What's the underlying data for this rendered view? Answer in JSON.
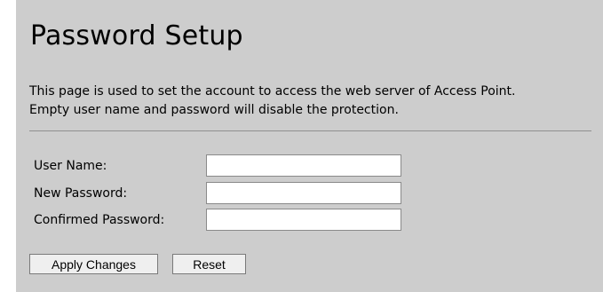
{
  "page": {
    "title": "Password Setup",
    "description_line1": "This page is used to set the account to access the web server of Access Point.",
    "description_line2": "Empty user name and password will disable the protection."
  },
  "form": {
    "username": {
      "label": "User Name:",
      "value": ""
    },
    "new_password": {
      "label": "New Password:",
      "value": ""
    },
    "confirmed_password": {
      "label": "Confirmed Password:",
      "value": ""
    }
  },
  "buttons": {
    "apply_label": "Apply Changes",
    "reset_label": "Reset"
  }
}
